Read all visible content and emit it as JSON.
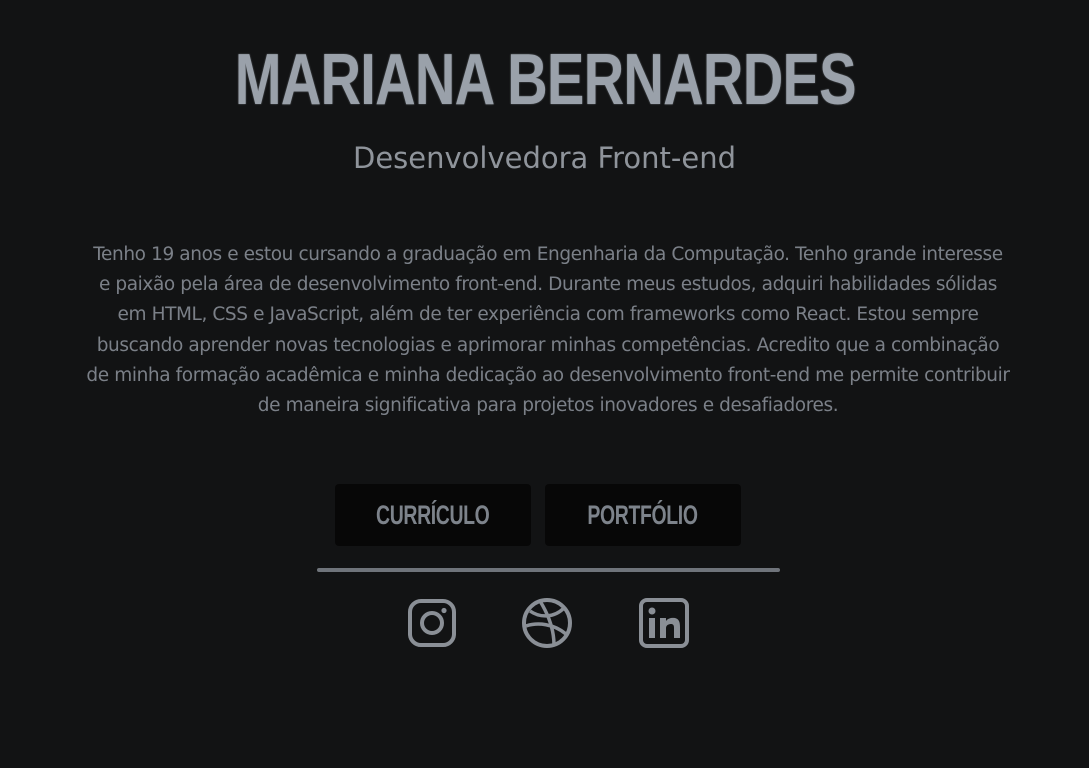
{
  "profile": {
    "name": "MARIANA BERNARDES",
    "role": "Desenvolvedora Front-end",
    "bio": "Tenho 19 anos e estou cursando a graduação em Engenharia da Computação. Tenho grande interesse e paixão pela área de desenvolvimento front-end. Durante meus estudos, adquiri habilidades sólidas em HTML, CSS e JavaScript, além de ter experiência com frameworks como React. Estou sempre buscando aprender novas tecnologias e aprimorar minhas competências. Acredito que a combinação de minha formação acadêmica e minha dedicação ao desenvolvimento front-end me permite contribuir de maneira significativa para projetos inovadores e desafiadores."
  },
  "buttons": {
    "curriculo": "CURRÍCULO",
    "portfolio": "PORTFÓLIO"
  },
  "social": {
    "icons": [
      "instagram-icon",
      "dribbble-icon",
      "linkedin-icon"
    ],
    "icon_color": "#8a8f96"
  },
  "colors": {
    "background": "#121314",
    "name": "#9aa1aa",
    "button_bg": "#070707",
    "divider": "#6f747b"
  }
}
